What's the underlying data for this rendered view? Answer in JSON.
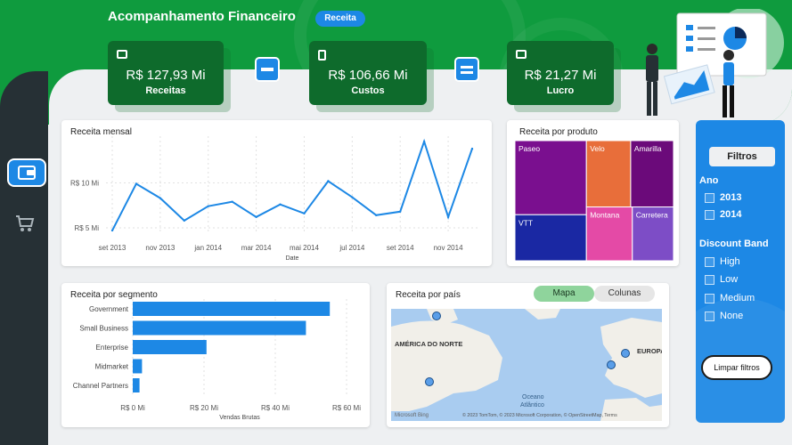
{
  "header": {
    "title": "Acompanhamento Financeiro",
    "pill": "Receita"
  },
  "kpis": [
    {
      "value": "R$ 127,93 Mi",
      "label": "Receitas"
    },
    {
      "value": "R$ 106,66 Mi",
      "label": "Custos"
    },
    {
      "value": "R$ 21,27 Mi",
      "label": "Lucro"
    }
  ],
  "colors": {
    "green": "#0f9b3e",
    "dark_green": "#0e6b2c",
    "accent_blue": "#1d88e5",
    "sidebar": "#263035"
  },
  "icons": {
    "nav_active": "wallet-icon",
    "nav_cart": "cart-icon"
  },
  "monthly": {
    "title": "Receita mensal",
    "xlabel": "Date"
  },
  "products": {
    "title": "Receita por produto",
    "items": [
      "Paseo",
      "Velo",
      "Amarilla",
      "VTT",
      "Montana",
      "Carretera"
    ]
  },
  "segments": {
    "title": "Receita por segmento",
    "xlabel": "Vendas Brutas"
  },
  "country": {
    "title": "Receita por país",
    "toggle_map": "Mapa",
    "toggle_cols": "Colunas",
    "map_label_na": "AMÉRICA DO NORTE",
    "map_label_eu": "EUROPA",
    "map_ocean": "Oceano",
    "map_ocean2": "Atlântico",
    "map_brand": "Microsoft Bing",
    "map_credit": "© 2023 TomTom, © 2023 Microsoft Corporation, © OpenStreetMap, Terms"
  },
  "filters": {
    "title": "Filtros",
    "year_head": "Ano",
    "years": [
      "2013",
      "2014"
    ],
    "discount_head": "Discount Band",
    "discounts": [
      "High",
      "Low",
      "Medium",
      "None"
    ],
    "clear": "Limpar filtros"
  },
  "chart_data": [
    {
      "type": "line",
      "title": "Receita mensal",
      "xlabel": "Date",
      "ylabel": "",
      "x": [
        "set 2013",
        "out 2013",
        "nov 2013",
        "dez 2013",
        "jan 2014",
        "fev 2014",
        "mar 2014",
        "abr 2014",
        "mai 2014",
        "jun 2014",
        "jul 2014",
        "ago 2014",
        "set 2014",
        "out 2014",
        "nov 2014",
        "dez 2014"
      ],
      "x_tick_labels": [
        "set 2013",
        "nov 2013",
        "jan 2014",
        "mar 2014",
        "mai 2014",
        "jul 2014",
        "set 2014",
        "nov 2014"
      ],
      "y_tick_labels": [
        "R$ 5 Mi",
        "R$ 10 Mi"
      ],
      "values": [
        4.7,
        9.9,
        8.3,
        5.8,
        7.4,
        7.9,
        6.2,
        7.6,
        6.6,
        10.2,
        8.4,
        6.4,
        6.8,
        14.6,
        6.2,
        13.8
      ],
      "ylim": [
        4.5,
        15
      ],
      "grid": true
    },
    {
      "type": "treemap",
      "title": "Receita por produto",
      "categories": [
        "Paseo",
        "Velo",
        "Amarilla",
        "VTT",
        "Montana",
        "Carretera"
      ],
      "values": [
        33.0,
        18.3,
        17.7,
        20.5,
        15.4,
        13.8
      ],
      "colors": [
        "#7a0f8f",
        "#e86e3a",
        "#6b0a7a",
        "#1a28a3",
        "#e44aa6",
        "#7d4dc6"
      ]
    },
    {
      "type": "bar",
      "orientation": "horizontal",
      "title": "Receita por segmento",
      "xlabel": "Vendas Brutas",
      "categories": [
        "Government",
        "Small Business",
        "Enterprise",
        "Midmarket",
        "Channel Partners"
      ],
      "values": [
        55.3,
        48.6,
        20.7,
        2.6,
        1.9
      ],
      "x_tick_labels": [
        "R$ 0 Mi",
        "R$ 20 Mi",
        "R$ 40 Mi",
        "R$ 60 Mi"
      ],
      "xlim": [
        0,
        60
      ]
    }
  ]
}
